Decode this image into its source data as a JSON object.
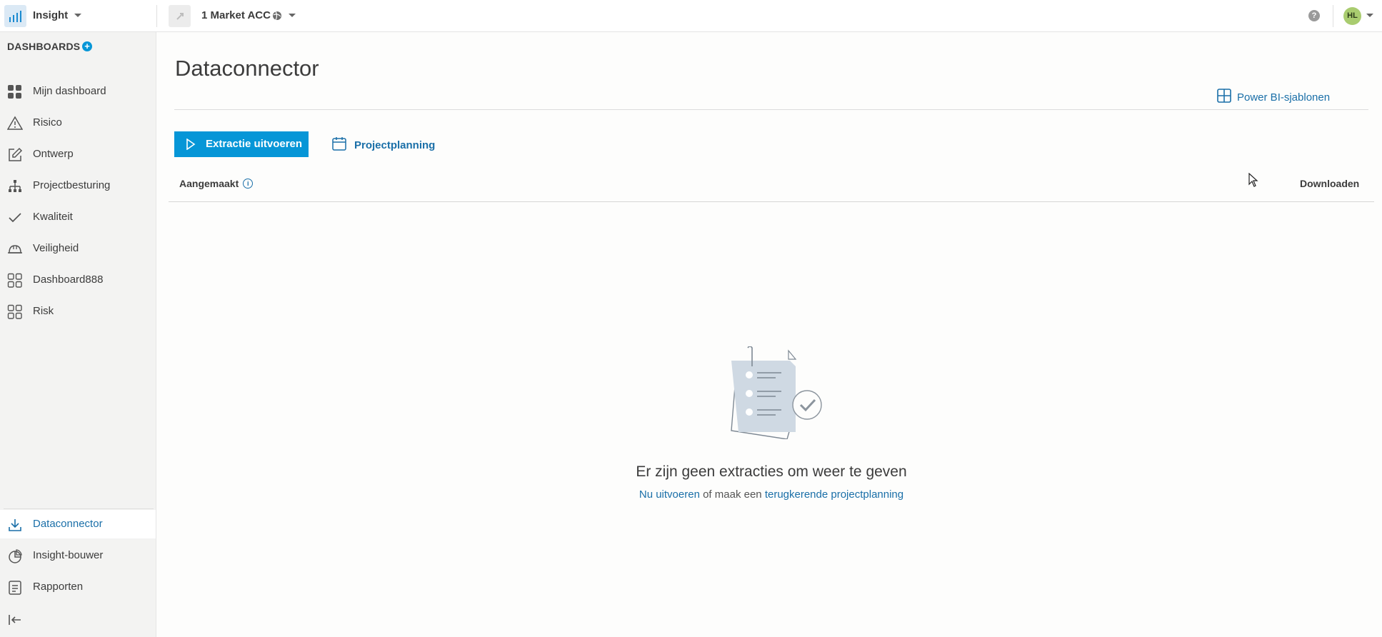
{
  "topbar": {
    "app_name": "Insight",
    "project_name": "1 Market ACC",
    "help_label": "?",
    "avatar_initials": "HL"
  },
  "sidebar": {
    "heading": "DASHBOARDS",
    "add_label": "+",
    "items": [
      {
        "label": "Mijn dashboard",
        "icon": "grid-filled-icon"
      },
      {
        "label": "Risico",
        "icon": "warning-icon"
      },
      {
        "label": "Ontwerp",
        "icon": "edit-icon"
      },
      {
        "label": "Projectbesturing",
        "icon": "hierarchy-icon"
      },
      {
        "label": "Kwaliteit",
        "icon": "check-icon"
      },
      {
        "label": "Veiligheid",
        "icon": "hardhat-icon"
      },
      {
        "label": "Dashboard888",
        "icon": "grid-outline-icon"
      },
      {
        "label": "Risk",
        "icon": "grid-outline-icon"
      }
    ],
    "bottom_items": [
      {
        "label": "Dataconnector",
        "icon": "download-icon",
        "active": true
      },
      {
        "label": "Insight-bouwer",
        "icon": "pie-chart-icon",
        "active": false
      },
      {
        "label": "Rapporten",
        "icon": "report-icon",
        "active": false
      }
    ],
    "collapse_icon": "collapse-left-icon"
  },
  "main": {
    "title": "Dataconnector",
    "powerbi_link": "Power BI-sjablonen",
    "run_button": "Extractie uitvoeren",
    "schedule_link": "Projectplanning",
    "table": {
      "col_created": "Aangemaakt",
      "col_download": "Downloaden"
    },
    "empty": {
      "title": "Er zijn geen extracties om weer te geven",
      "link_run": "Nu uitvoeren",
      "middle_text": " of maak een ",
      "link_schedule": "terugkerende projectplanning"
    }
  },
  "colors": {
    "accent": "#0696d7",
    "link": "#1a6fa8",
    "sidebar_bg": "#f3f3f2"
  }
}
